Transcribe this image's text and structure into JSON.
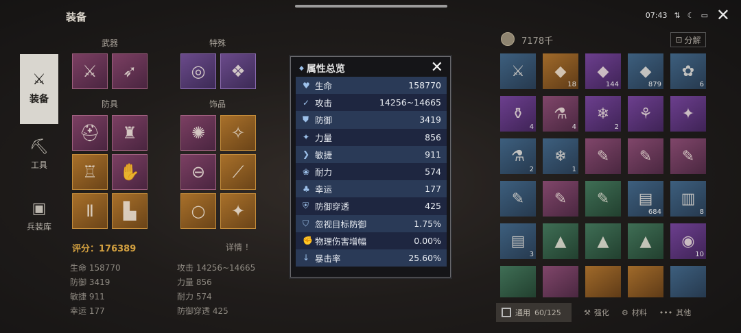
{
  "header": {
    "title": "装备",
    "time": "07:43"
  },
  "nav": [
    {
      "label": "装备",
      "icon": "sword-icon"
    },
    {
      "label": "工具",
      "icon": "pickaxe-icon"
    },
    {
      "label": "兵装库",
      "icon": "storage-icon"
    }
  ],
  "equipment": {
    "groups": {
      "weapon": "武器",
      "special": "特殊",
      "armor": "防具",
      "accessory": "饰品"
    },
    "score_label": "评分：176389",
    "detail_label": "详情"
  },
  "summary_stats": [
    {
      "label": "生命 158770"
    },
    {
      "label": "攻击 14256~14665"
    },
    {
      "label": "防御 3419"
    },
    {
      "label": "力量 856"
    },
    {
      "label": "敏捷 911"
    },
    {
      "label": "耐力 574"
    },
    {
      "label": "幸运 177"
    },
    {
      "label": "防御穿透 425"
    }
  ],
  "inventory": {
    "gold": "7178千",
    "decompose_label": "分解",
    "counts": [
      "",
      "18",
      "144",
      "879",
      "6",
      "4",
      "4",
      "2",
      "",
      "",
      "2",
      "1",
      "",
      "",
      "",
      "",
      "",
      "",
      "684",
      "8",
      "3",
      "",
      "",
      "",
      "10"
    ],
    "tabs": {
      "general": "通用",
      "capacity": "60/125",
      "enhance": "强化",
      "material": "材料",
      "other": "其他"
    }
  },
  "modal": {
    "title": "属性总览",
    "rows": [
      {
        "label": "生命",
        "value": "158770"
      },
      {
        "label": "攻击",
        "value": "14256~14665"
      },
      {
        "label": "防御",
        "value": "3419"
      },
      {
        "label": "力量",
        "value": "856"
      },
      {
        "label": "敏捷",
        "value": "911"
      },
      {
        "label": "耐力",
        "value": "574"
      },
      {
        "label": "幸运",
        "value": "177"
      },
      {
        "label": "防御穿透",
        "value": "425"
      },
      {
        "label": "忽视目标防御",
        "value": "1.75%"
      },
      {
        "label": "物理伤害增幅",
        "value": "0.00%"
      },
      {
        "label": "暴击率",
        "value": "25.60%"
      }
    ]
  }
}
